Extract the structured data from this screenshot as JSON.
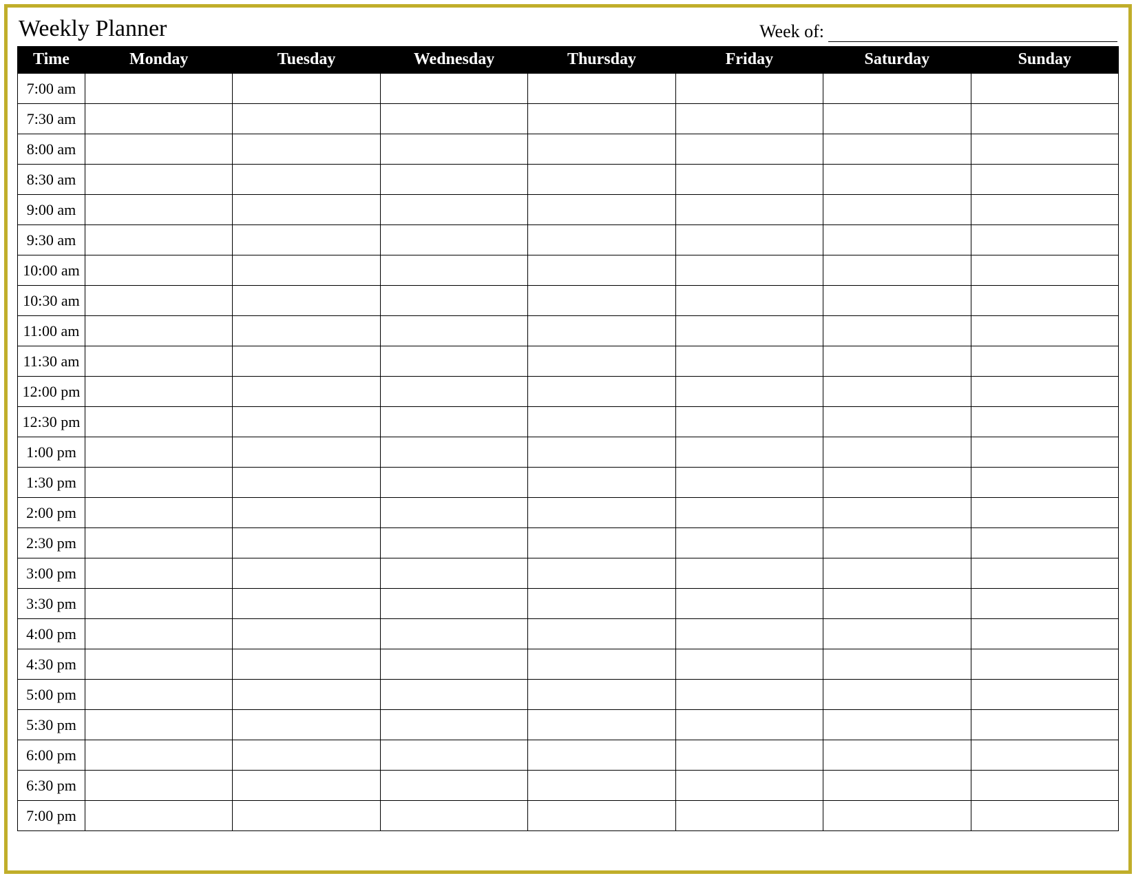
{
  "header": {
    "title": "Weekly Planner",
    "week_of_label": "Week of:",
    "week_of_value": ""
  },
  "columns": {
    "time": "Time",
    "days": [
      "Monday",
      "Tuesday",
      "Wednesday",
      "Thursday",
      "Friday",
      "Saturday",
      "Sunday"
    ]
  },
  "time_slots": [
    "7:00 am",
    "7:30 am",
    "8:00 am",
    "8:30 am",
    "9:00 am",
    "9:30 am",
    "10:00 am",
    "10:30 am",
    "11:00 am",
    "11:30 am",
    "12:00 pm",
    "12:30 pm",
    "1:00 pm",
    "1:30 pm",
    "2:00 pm",
    "2:30 pm",
    "3:00 pm",
    "3:30 pm",
    "4:00 pm",
    "4:30 pm",
    "5:00 pm",
    "5:30 pm",
    "6:00 pm",
    "6:30 pm",
    "7:00 pm"
  ]
}
